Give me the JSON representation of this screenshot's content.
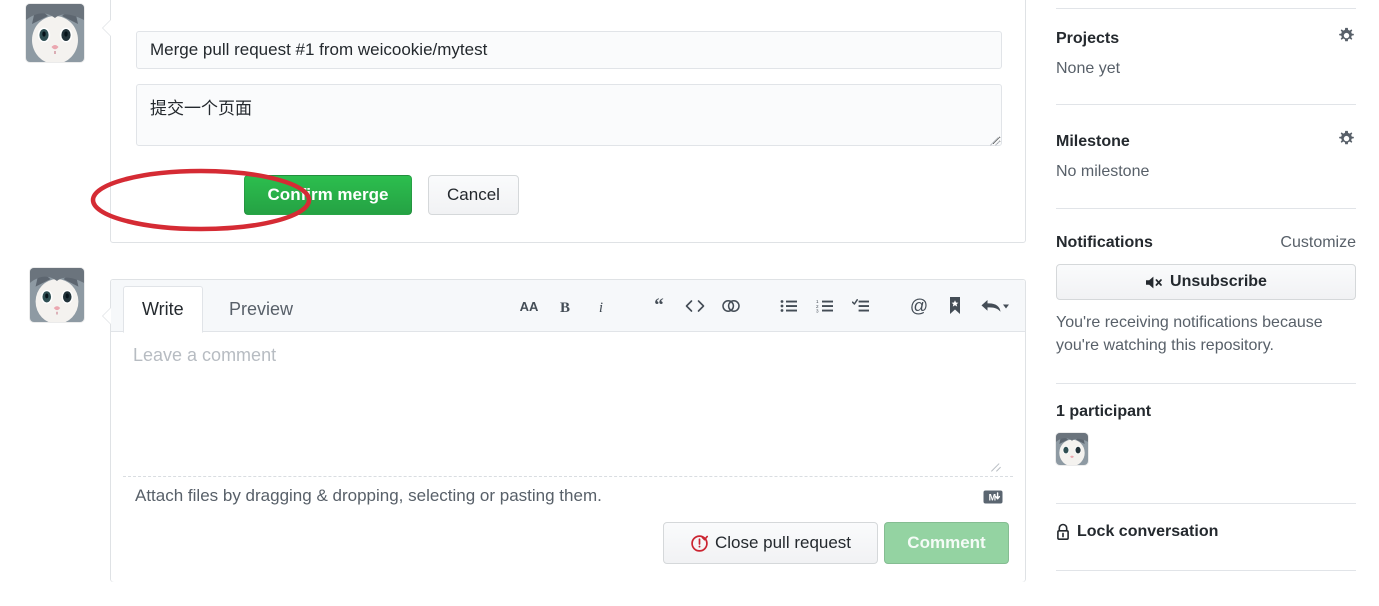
{
  "merge_box": {
    "commit_title": "Merge pull request #1 from weicookie/mytest",
    "commit_description": "提交一个页面",
    "confirm_label": "Confirm merge",
    "cancel_label": "Cancel"
  },
  "comment_form": {
    "tabs": [
      {
        "label": "Write",
        "active": true
      },
      {
        "label": "Preview",
        "active": false
      }
    ],
    "toolbar_icons": [
      "heading-icon",
      "bold-icon",
      "italic-icon",
      "quote-icon",
      "code-icon",
      "link-icon",
      "unordered-list-icon",
      "ordered-list-icon",
      "task-list-icon",
      "mention-icon",
      "saved-reply-icon",
      "reply-icon"
    ],
    "comment_placeholder": "Leave a comment",
    "comment_value": "",
    "attach_hint": "Attach files by dragging & dropping, selecting or pasting them.",
    "markdown_icon": "markdown-icon",
    "close_pr_label": "Close pull request",
    "comment_label": "Comment"
  },
  "sidebar": {
    "projects": {
      "title": "Projects",
      "value": "None yet",
      "gear_icon": "gear-icon"
    },
    "milestone": {
      "title": "Milestone",
      "value": "No milestone",
      "gear_icon": "gear-icon"
    },
    "notifications": {
      "title": "Notifications",
      "customize_label": "Customize",
      "unsubscribe_label": "Unsubscribe",
      "unsubscribe_icon": "mute-icon",
      "note": "You're receiving notifications because you're watching this repository."
    },
    "participants": {
      "title": "1 participant"
    },
    "lock": {
      "label": "Lock conversation",
      "icon": "lock-icon"
    }
  },
  "annotation": {
    "shape": "ellipse",
    "color": "#d52b34",
    "target": "Confirm merge"
  },
  "colors": {
    "merge_green": "#2cbe4e",
    "comment_green_disabled": "#94d3a2",
    "border": "#dfe2e5",
    "muted_text": "#586069",
    "text": "#24292e",
    "close_pr_red": "#cb2431"
  }
}
